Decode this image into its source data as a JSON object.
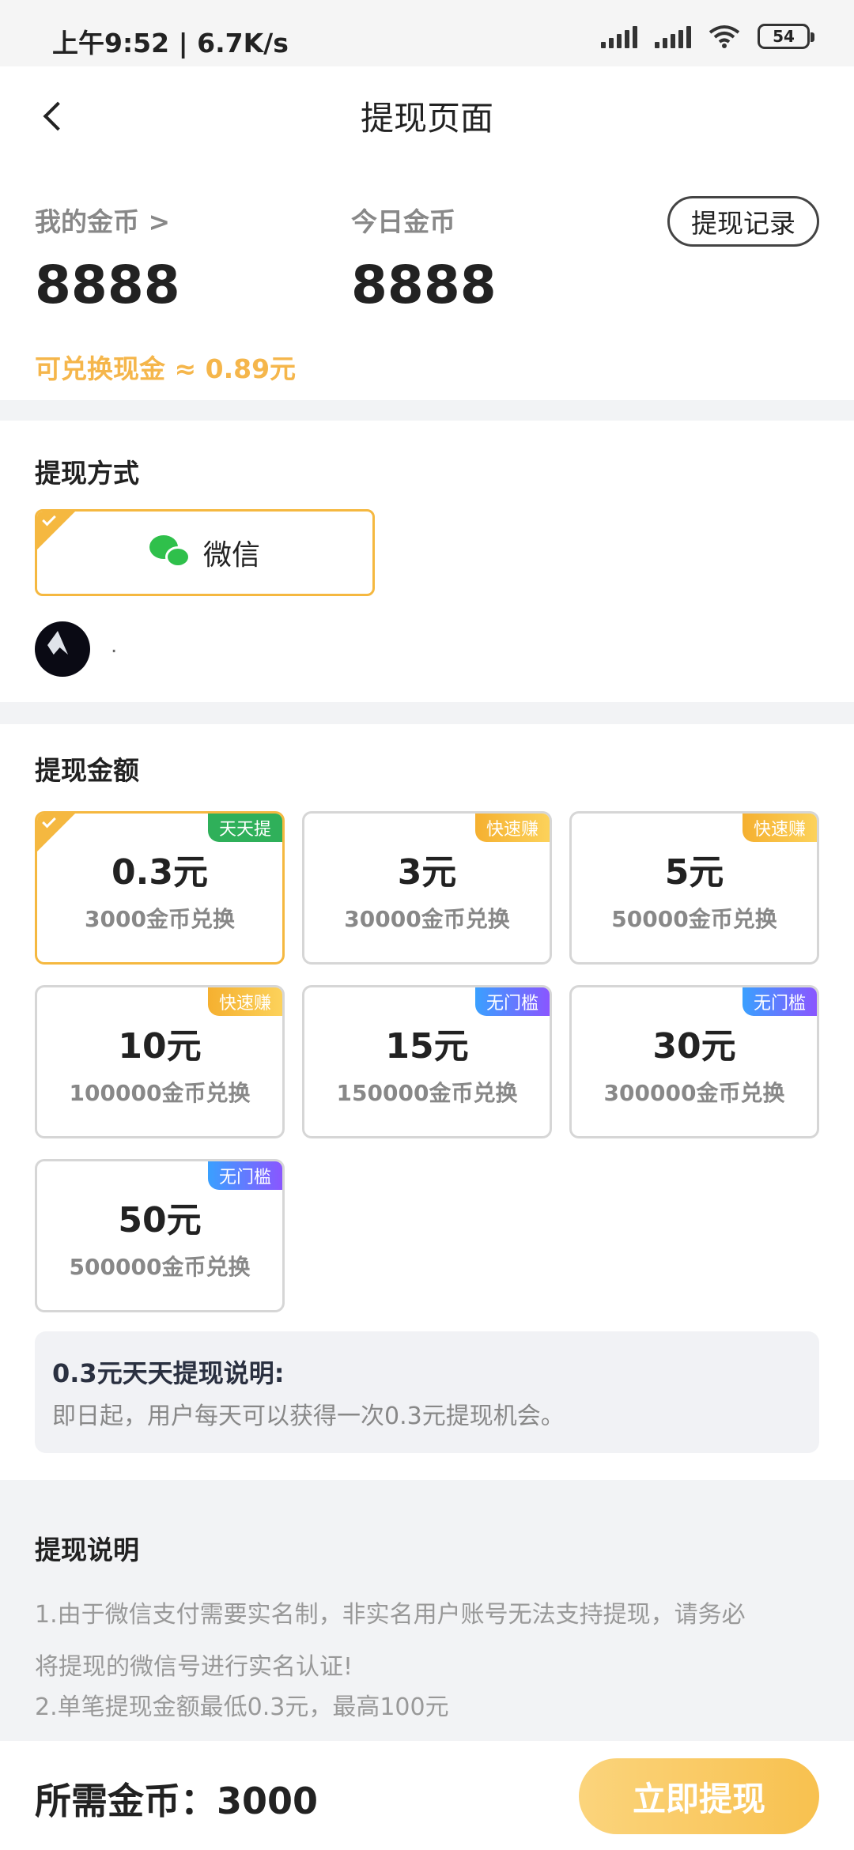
{
  "status": {
    "time": "上午9:52 | 6.7K/s",
    "battery": "54"
  },
  "nav": {
    "title": "提现页面"
  },
  "wallet": {
    "my_label": "我的金币 >",
    "my_value": "8888",
    "today_label": "今日金币",
    "today_value": "8888",
    "record_label": "提现记录",
    "exchange_text": "可兑换现金 ≈ 0.89元"
  },
  "method": {
    "title": "提现方式",
    "wechat_label": "微信",
    "nickname": "."
  },
  "amount": {
    "title": "提现金额",
    "options": [
      {
        "price": "0.3元",
        "cost": "3000金币兑换",
        "tag": "天天提"
      },
      {
        "price": "3元",
        "cost": "30000金币兑换",
        "tag": "快速赚"
      },
      {
        "price": "5元",
        "cost": "50000金币兑换",
        "tag": "快速赚"
      },
      {
        "price": "10元",
        "cost": "100000金币兑换",
        "tag": "快速赚"
      },
      {
        "price": "15元",
        "cost": "150000金币兑换",
        "tag": "无门槛"
      },
      {
        "price": "30元",
        "cost": "300000金币兑换",
        "tag": "无门槛"
      },
      {
        "price": "50元",
        "cost": "500000金币兑换",
        "tag": "无门槛"
      }
    ],
    "note_title": "0.3元天天提现说明:",
    "note_text": "即日起，用户每天可以获得一次0.3元提现机会。"
  },
  "explain": {
    "title": "提现说明",
    "line1a": "1.由于微信支付需要实名制，非实名用户账号无法支持提现，请务必",
    "line1b": "将提现的微信号进行实名认证!",
    "line2": "2.单笔提现金额最低0.3元，最高100元"
  },
  "bottom": {
    "need": "所需金币：3000",
    "button": "立即提现"
  },
  "colors": {
    "accent": "#f5b840",
    "exchange": "#f5b64b",
    "wechat": "#2fc04b"
  }
}
